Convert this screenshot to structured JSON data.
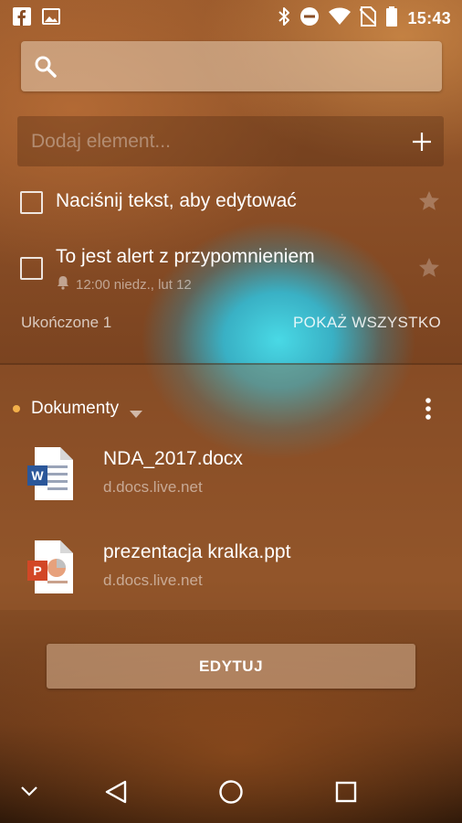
{
  "status_bar": {
    "time": "15:43",
    "left_icons": [
      "facebook-icon",
      "gallery-icon"
    ],
    "right_icons": [
      "bluetooth-icon",
      "do-not-disturb-icon",
      "wifi-icon",
      "no-sim-icon",
      "battery-icon"
    ]
  },
  "search": {
    "placeholder": ""
  },
  "add_item": {
    "placeholder": "Dodaj element..."
  },
  "tasks": [
    {
      "title": "Naciśnij tekst, aby edytować",
      "reminder": ""
    },
    {
      "title": "To jest alert z przypomnieniem",
      "reminder": "12:00 niedz., lut 12"
    }
  ],
  "completed": {
    "label": "Ukończone 1",
    "show_all": "POKAŻ WSZYSTKO"
  },
  "documents": {
    "title": "Dokumenty",
    "items": [
      {
        "name": "NDA_2017.docx",
        "url": "d.docs.live.net",
        "icon": "word-file-icon"
      },
      {
        "name": "prezentacja kralka.ppt",
        "url": "d.docs.live.net",
        "icon": "powerpoint-file-icon"
      }
    ]
  },
  "edit_button": {
    "label": "EDYTUJ"
  },
  "nav": [
    "collapse-icon",
    "back-icon",
    "home-icon",
    "recents-icon"
  ],
  "colors": {
    "accent_dot": "#f3b04a",
    "word_blue": "#2b579a",
    "ppt_red": "#d24726"
  }
}
